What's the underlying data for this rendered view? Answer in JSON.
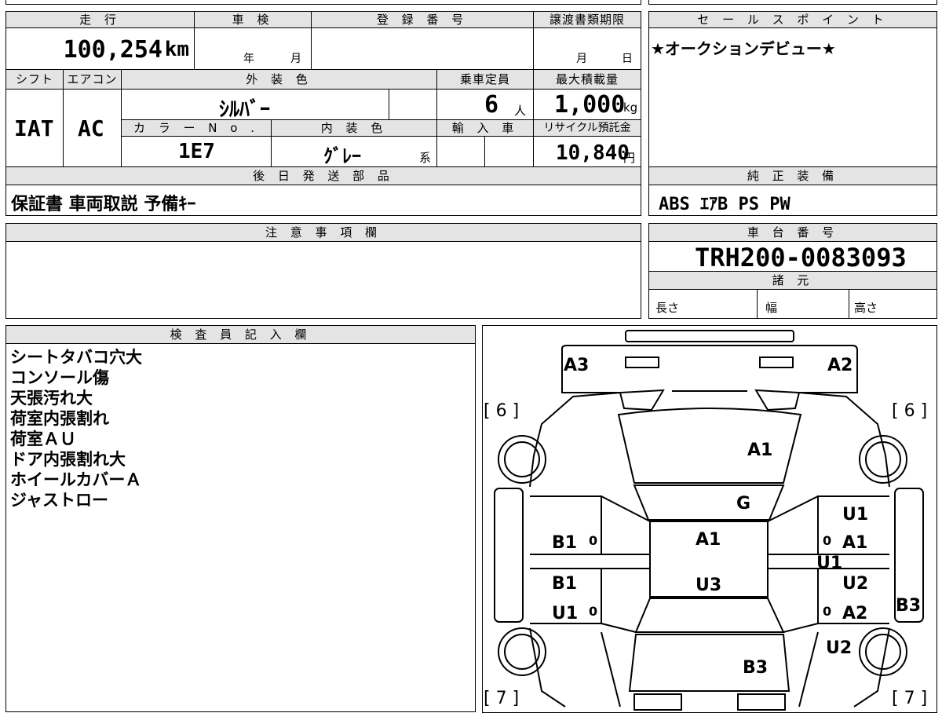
{
  "labels": {
    "mileage": "走 行",
    "inspection": "車 検",
    "registration": "登 録 番 号",
    "transfer_deadline": "譲渡書類期限",
    "sales_point": "セ ー ル ス ポ イ ン ト",
    "shift": "シフト",
    "aircon": "エアコン",
    "exterior_color": "外 装 色",
    "capacity": "乗車定員",
    "max_load": "最大積載量",
    "color_no": "カ ラ ー N o .",
    "interior_color": "内 装 色",
    "import": "輸 入 車",
    "recycle": "リサイクル預託金",
    "later_parts": "後 日 発 送 部 品",
    "std_equipment": "純 正 装 備",
    "notes": "注 意 事 項 欄",
    "chassis": "車 台 番 号",
    "specs": "諸 元",
    "length": "長さ",
    "width": "幅",
    "height": "高さ",
    "inspector": "検 査 員 記 入 欄"
  },
  "values": {
    "mileage": "100,254",
    "mileage_unit": "km",
    "year_unit": "年",
    "month_unit": "月",
    "deadline_month": "月",
    "deadline_day": "日",
    "sales_point": "★オークションデビュー★",
    "shift": "IAT",
    "aircon": "AC",
    "exterior_color": "ｼﾙﾊﾞｰ",
    "capacity": "6",
    "capacity_unit": "人",
    "max_load": "1,000",
    "max_load_unit": "kg",
    "color_no": "1E7",
    "interior_color": "ｸﾞﾚｰ",
    "interior_suffix": "系",
    "recycle": "10,840",
    "recycle_unit": "円",
    "later_parts": "保証書 車両取説 予備ｷｰ",
    "std_equipment": "ABS ｴｱB PS PW",
    "chassis": "TRH200-0083093"
  },
  "inspector_notes": [
    "シートタバコ穴大",
    "コンソール傷",
    "天張汚れ大",
    "荷室内張割れ",
    "荷室ＡＵ",
    "ドア内張割れ大",
    "ホイールカバーＡ",
    "ジャストロー"
  ],
  "diagram_marks": {
    "a3": "A3",
    "a2": "A2",
    "six_l": "[ 6 ]",
    "six_r": "[ 6 ]",
    "seven_l": "[ 7 ]",
    "seven_r": "[ 7 ]",
    "hood": "A1",
    "windshield": "G",
    "roof": "A1",
    "roof2": "U3",
    "l_front_door": "B1",
    "l_rear_door1": "B1",
    "l_rear_door2": "U1",
    "r_front_door1": "U1",
    "r_front_door2": "A1",
    "r_mid": "U1",
    "r_rear_door1": "U2",
    "r_rear_door2": "A2",
    "r_quarter": "B3",
    "r_rear": "U2",
    "rear": "B3",
    "zero_a": "0",
    "zero_b": "0",
    "zero_c": "0",
    "zero_d": "0"
  }
}
